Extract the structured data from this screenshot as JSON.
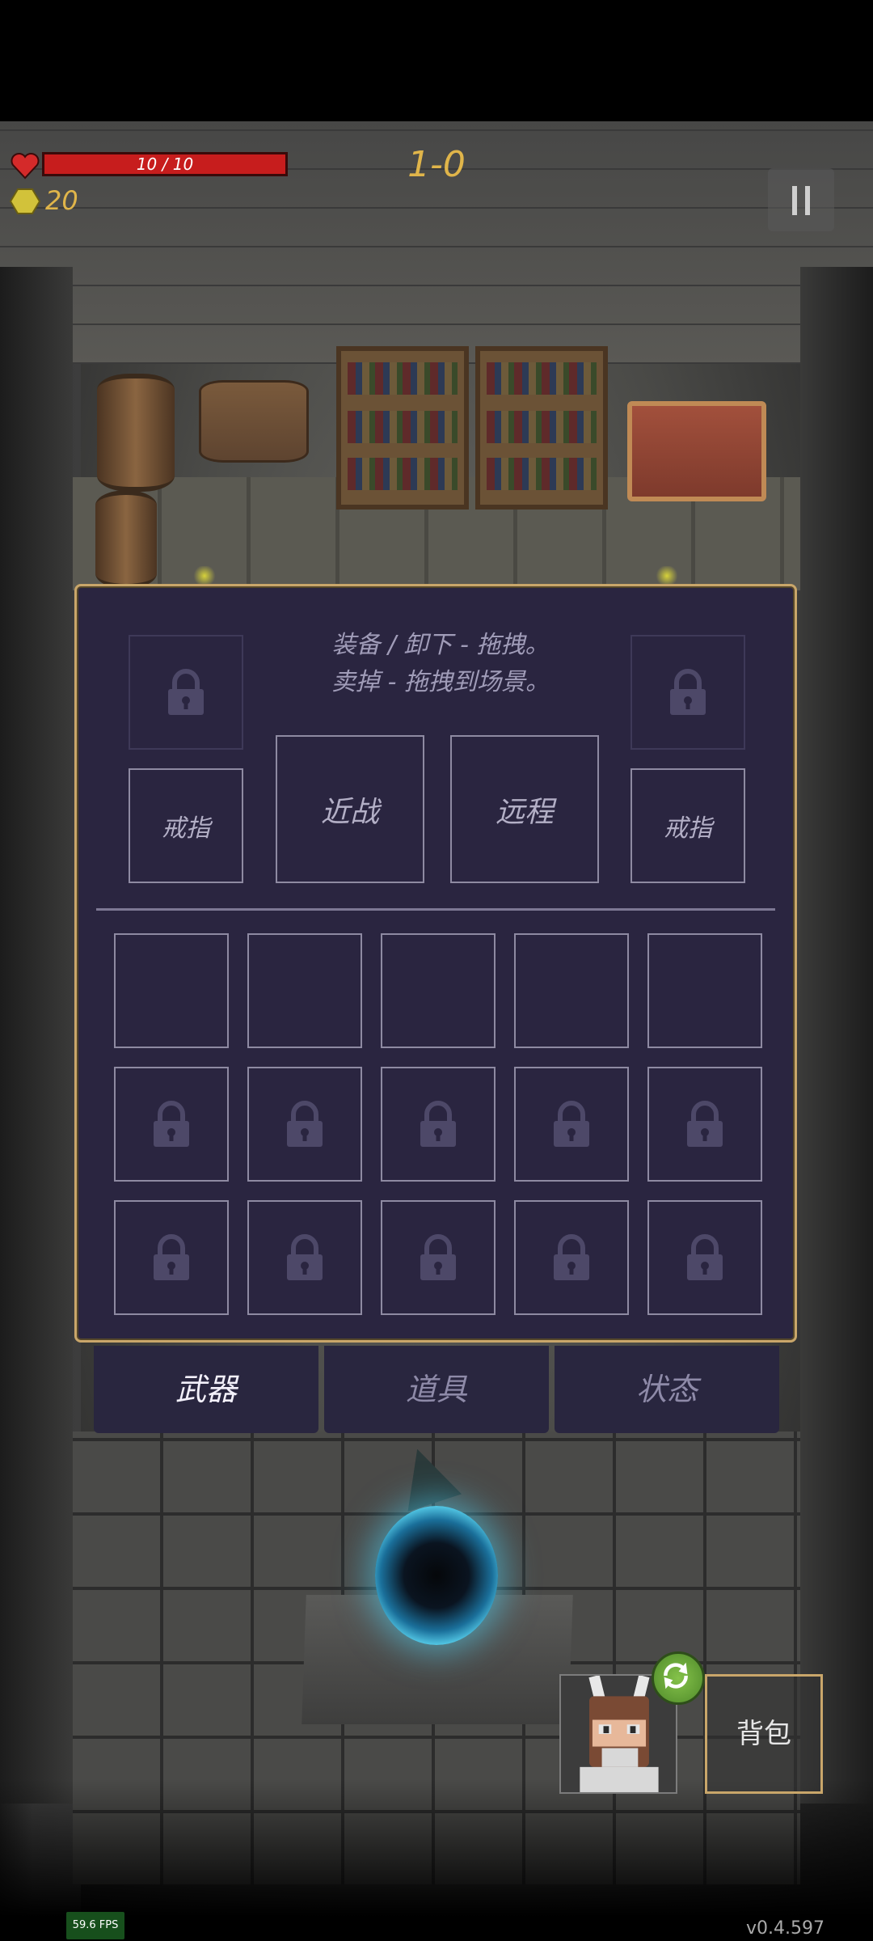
{
  "hud": {
    "hp_text": "10 / 10",
    "hp_fraction": 1.0,
    "stage": "1-0",
    "gold": "20",
    "colors": {
      "hp": "#c71d1d",
      "gold_text": "#e0b54a"
    }
  },
  "inventory": {
    "hint_line1": "装备 / 卸下 - 拖拽。",
    "hint_line2": "卖掉 - 拖拽到场景。",
    "equip_slots": {
      "ring_left": "戒指",
      "melee": "近战",
      "ranged": "远程",
      "ring_right": "戒指"
    },
    "grid": {
      "rows": [
        [
          false,
          false,
          false,
          false,
          false
        ],
        [
          true,
          true,
          true,
          true,
          true
        ],
        [
          true,
          true,
          true,
          true,
          true
        ]
      ]
    }
  },
  "tabs": [
    {
      "label": "武器",
      "active": true
    },
    {
      "label": "道具",
      "active": false
    },
    {
      "label": "状态",
      "active": false
    }
  ],
  "backpack_label": "背包",
  "fps": "59.6 FPS",
  "version": "v0.4.597",
  "icons": [
    "heart-icon",
    "coin-icon",
    "pause-icon",
    "lock-icon",
    "swap-icon",
    "hero-portrait"
  ]
}
